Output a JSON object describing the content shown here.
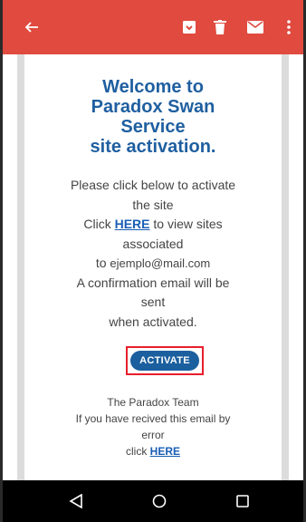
{
  "app_bar": {
    "color": "#e04a3f",
    "icons": [
      "back-arrow-icon",
      "archive-icon",
      "delete-icon",
      "mail-icon",
      "more-vert-icon"
    ]
  },
  "email": {
    "title_lines": [
      "Welcome to",
      "Paradox Swan",
      "Service",
      "site activation."
    ],
    "intro_line1": "Please click below to activate",
    "intro_line2": "the site",
    "click_prefix": "Click ",
    "here_link": "HERE",
    "click_suffix": " to view sites",
    "associated": "associated",
    "to_prefix": "to ",
    "email_address": "ejemplo@mail.com",
    "confirm_line1": "A confirmation email will be",
    "confirm_line2": "sent",
    "confirm_line3": "when activated.",
    "activate_label": "ACTIVATE",
    "team": "The Paradox Team",
    "error_line1": "If you have recived this email by",
    "error_line2": "error",
    "error_click": "click ",
    "error_here": "HERE"
  },
  "nav_bar": {
    "icons": [
      "nav-back-icon",
      "nav-home-icon",
      "nav-recent-icon"
    ]
  }
}
